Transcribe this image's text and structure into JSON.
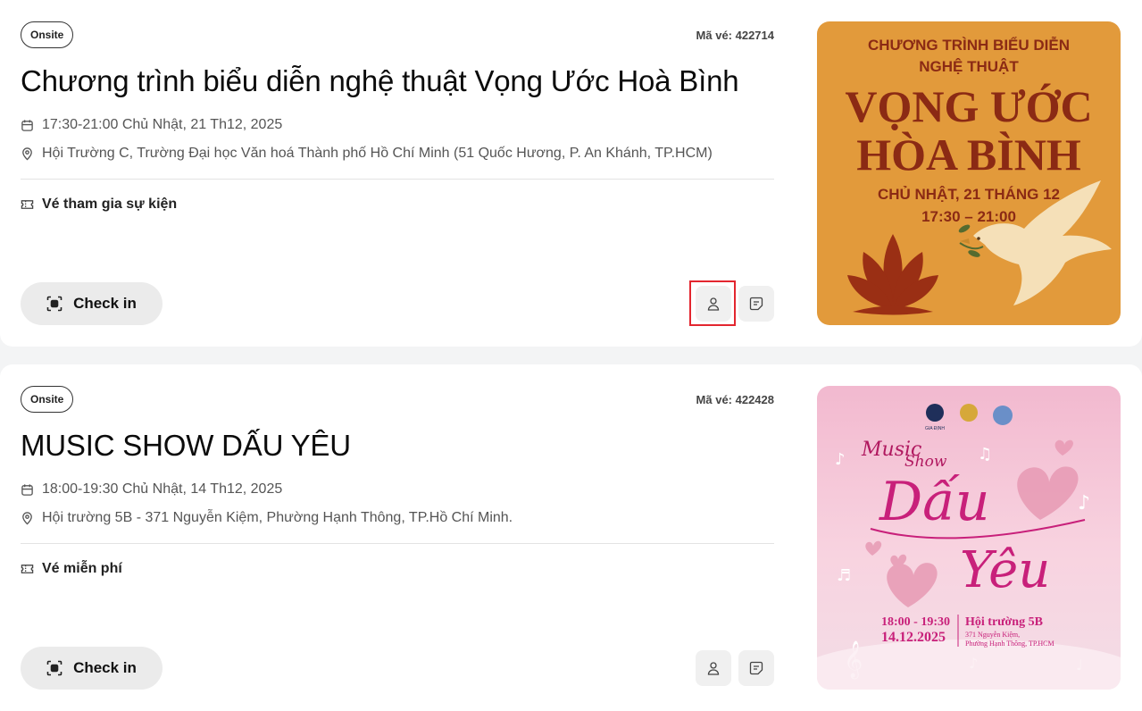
{
  "events": [
    {
      "badge": "Onsite",
      "ticket_code": "Mã vé: 422714",
      "title": "Chương trình biểu diễn nghệ thuật Vọng Ước Hoà Bình",
      "datetime": "17:30-21:00 Chủ Nhật, 21 Th12, 2025",
      "location": "Hội Trường C, Trường Đại học Văn hoá Thành phố Hồ Chí Minh (51 Quốc Hương, P. An Khánh, TP.HCM)",
      "ticket_type": "Vé tham gia sự kiện",
      "checkin_label": "Check in",
      "poster": {
        "line1": "CHƯƠNG TRÌNH BIỂU DIỄN",
        "line2": "NGHỆ THUẬT",
        "title1": "VỌNG ƯỚC",
        "title2": "HÒA BÌNH",
        "date": "CHỦ NHẬT, 21 THÁNG 12",
        "time": "17:30 – 21:00",
        "bg_color": "#e29a3b",
        "text_color": "#8b2a14"
      }
    },
    {
      "badge": "Onsite",
      "ticket_code": "Mã vé: 422428",
      "title": "MUSIC SHOW DẤU YÊU",
      "datetime": "18:00-19:30 Chủ Nhật, 14 Th12, 2025",
      "location": "Hội trường 5B - 371 Nguyễn Kiệm, Phường Hạnh Thông, TP.Hồ Chí Minh.",
      "ticket_type": "Vé miễn phí",
      "checkin_label": "Check in",
      "poster": {
        "logo1": "GIA ĐỊNH",
        "music": "Music",
        "show": "Show",
        "dau": "Dấu",
        "yeu": "Yêu",
        "time": "18:00 - 19:30",
        "date": "14.12.2025",
        "venue": "Hội trường 5B",
        "address1": "371 Nguyễn Kiệm,",
        "address2": "Phường Hạnh Thông, TP.HCM",
        "bg_color": "#f6c9d8",
        "accent_color": "#c8207a"
      }
    }
  ],
  "colors": {
    "highlight": "#e3262f",
    "page_bg": "#f3f4f5"
  }
}
